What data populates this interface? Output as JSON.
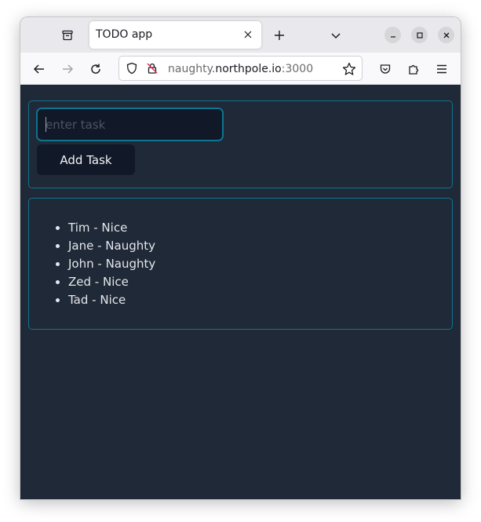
{
  "browser": {
    "tab_title": "TODO app",
    "url_host_prefix": "naughty.",
    "url_host_main": "northpole.io",
    "url_port": ":3000"
  },
  "form": {
    "input_placeholder": "enter task",
    "input_value": "",
    "add_button_label": "Add Task"
  },
  "tasks": [
    {
      "label": "Tim - Nice"
    },
    {
      "label": "Jane - Naughty"
    },
    {
      "label": "John - Naughty"
    },
    {
      "label": "Zed - Nice"
    },
    {
      "label": "Tad - Nice"
    }
  ],
  "colors": {
    "page_bg": "#1f2937",
    "accent_border": "#0e7490",
    "button_bg": "#111827"
  }
}
